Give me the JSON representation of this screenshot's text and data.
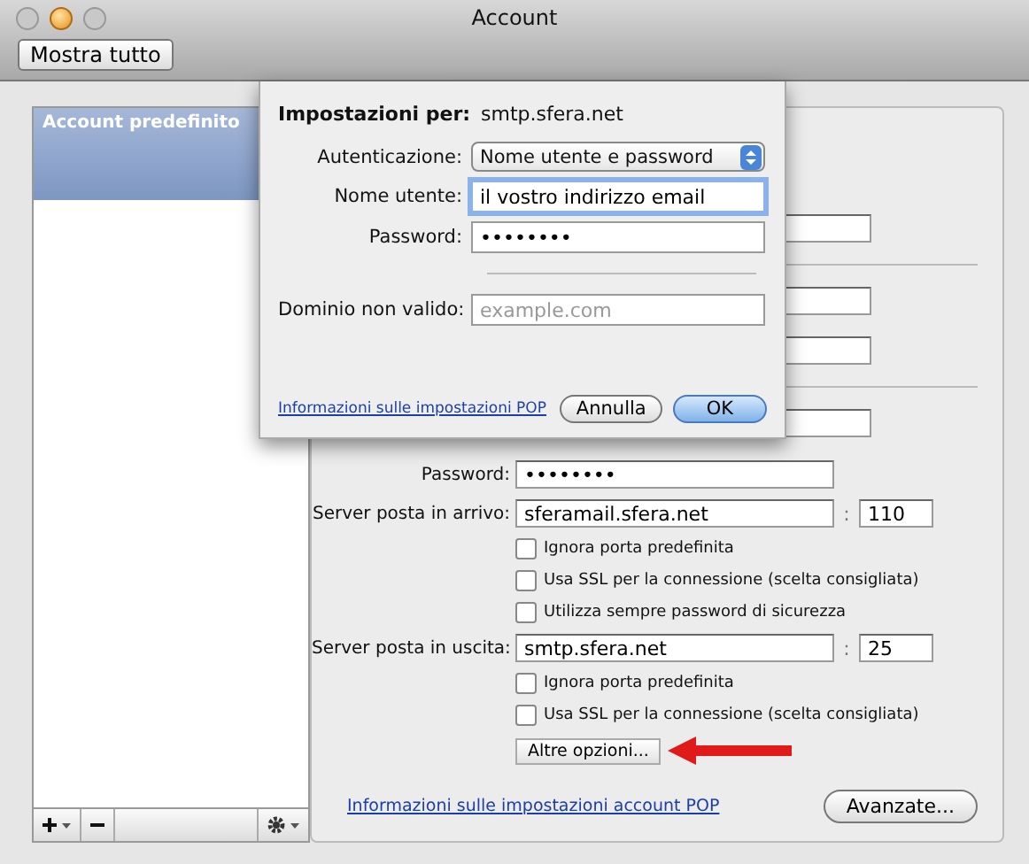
{
  "window": {
    "title": "Account"
  },
  "toolbar": {
    "show_all_button": "Mostra tutto"
  },
  "accounts": [
    {
      "label": "Account predefinito",
      "selected": true
    }
  ],
  "server_settings": {
    "password": {
      "label": "Password:",
      "value": "••••••••"
    },
    "incoming": {
      "label": "Server posta in arrivo:",
      "value": "sferamail.sfera.net",
      "separator": ":",
      "port": "110",
      "options": [
        {
          "label": "Ignora porta predefinita",
          "checked": false
        },
        {
          "label": "Usa SSL per la connessione (scelta consigliata)",
          "checked": false
        },
        {
          "label": "Utilizza sempre password di sicurezza",
          "checked": false
        }
      ]
    },
    "outgoing": {
      "label": "Server posta in uscita:",
      "value": "smtp.sfera.net",
      "separator": ":",
      "port": "25",
      "options": [
        {
          "label": "Ignora porta predefinita",
          "checked": false
        },
        {
          "label": "Usa SSL per la connessione (scelta consigliata)",
          "checked": false
        }
      ]
    },
    "more_options_button": "Altre opzioni...",
    "help_link": "Informazioni sulle impostazioni account POP",
    "advanced_button": "Avanzate..."
  },
  "sheet": {
    "heading_label": "Impostazioni per:",
    "heading_value": "smtp.sfera.net",
    "fields": [
      {
        "kind": "popup",
        "label": "Autenticazione:",
        "value": "Nome utente e password",
        "focused": false
      },
      {
        "kind": "text",
        "label": "Nome utente:",
        "value": "il vostro indirizzo email",
        "focused": true
      },
      {
        "kind": "text",
        "label": "Password:",
        "value": "••••••••",
        "focused": false
      },
      {
        "kind": "separator"
      },
      {
        "kind": "text",
        "label": "Dominio non valido:",
        "placeholder": "example.com",
        "focused": false
      }
    ],
    "help_link": "Informazioni sulle impostazioni POP",
    "buttons": [
      {
        "label": "Annulla",
        "default": false
      },
      {
        "label": "OK",
        "default": true
      }
    ]
  }
}
